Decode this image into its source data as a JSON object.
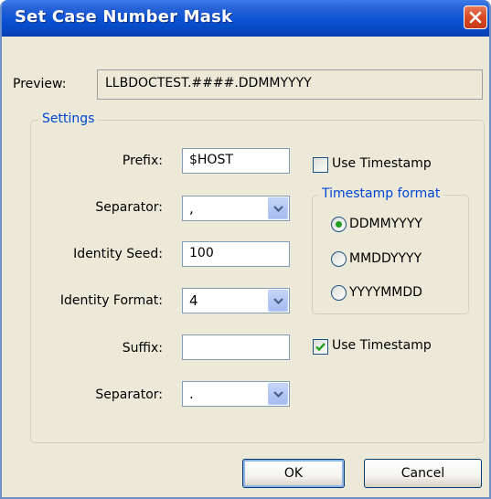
{
  "window": {
    "title": "Set Case Number Mask"
  },
  "preview": {
    "label": "Preview:",
    "value": "LLBDOCTEST.####.DDMMYYYY"
  },
  "settings": {
    "title": "Settings",
    "prefix": {
      "label": "Prefix:",
      "value": "$HOST"
    },
    "separator1": {
      "label": "Separator:",
      "value": ","
    },
    "identity_seed": {
      "label": "Identity Seed:",
      "value": "100"
    },
    "identity_format": {
      "label": "Identity Format:",
      "value": "4"
    },
    "suffix": {
      "label": "Suffix:",
      "value": ""
    },
    "separator2": {
      "label": "Separator:",
      "value": "."
    },
    "prefix_use_timestamp": {
      "label": "Use Timestamp",
      "checked": false
    },
    "suffix_use_timestamp": {
      "label": "Use Timestamp",
      "checked": true
    },
    "timestamp_format": {
      "title": "Timestamp format",
      "options": [
        {
          "label": "DDMMYYYY",
          "selected": true
        },
        {
          "label": "MMDDYYYY",
          "selected": false
        },
        {
          "label": "YYYYMMDD",
          "selected": false
        }
      ]
    }
  },
  "buttons": {
    "ok": "OK",
    "cancel": "Cancel"
  },
  "colors": {
    "titlebar": "#0a53d4",
    "window_bg": "#ece9d8",
    "group_title": "#0046d5",
    "radio_dot": "#21a121",
    "check_mark": "#21a121",
    "close_button": "#d84a22"
  }
}
